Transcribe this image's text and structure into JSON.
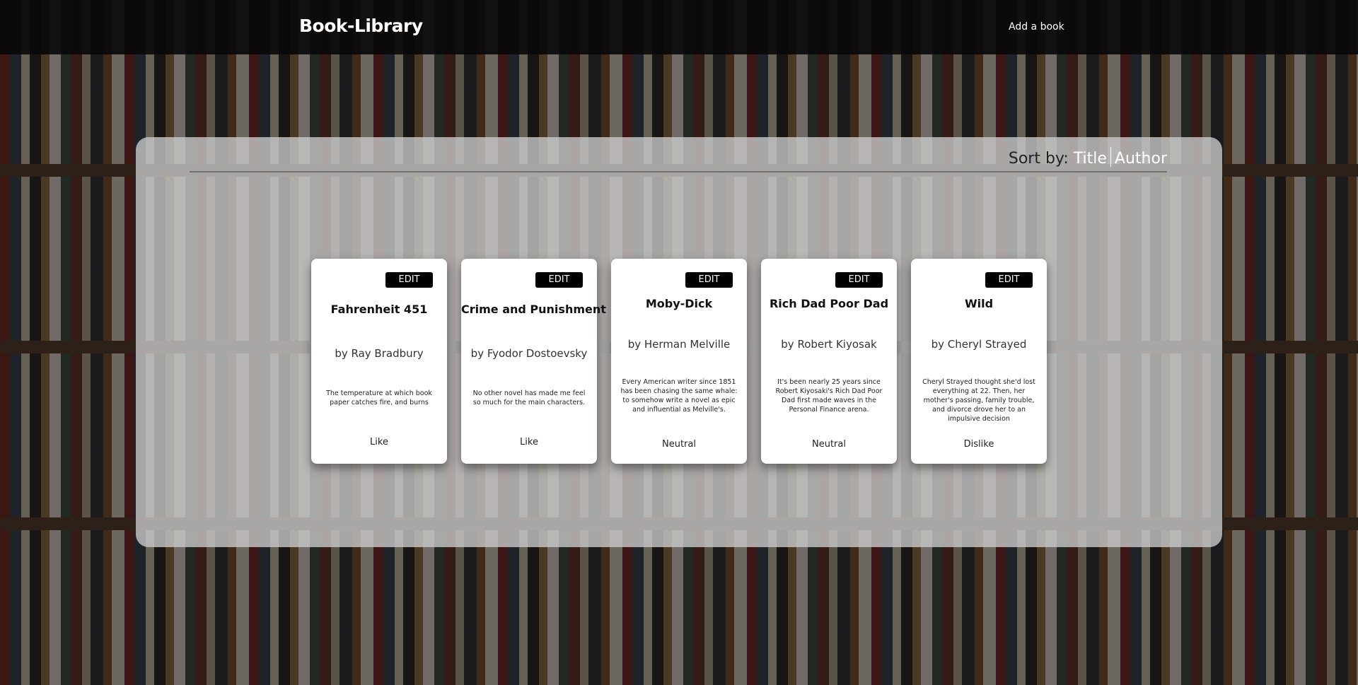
{
  "header": {
    "brand": "Book-Library",
    "add_book_link": "Add a book"
  },
  "sort": {
    "label": "Sort by:",
    "options": [
      "Title",
      "Author"
    ]
  },
  "books": [
    {
      "edit_label": "EDIT",
      "title": "Fahrenheit 451",
      "author": "by Ray Bradbury",
      "description": "The temperature at which book paper catches fire, and burns",
      "rating": "Like"
    },
    {
      "edit_label": "EDIT",
      "title": "Crime and Punishment",
      "author": "by Fyodor Dostoevsky",
      "description": "No other novel has made me feel so much for the main characters.",
      "rating": "Like"
    },
    {
      "edit_label": "EDIT",
      "title": "Moby-Dick",
      "author": "by Herman Melville",
      "description": "Every American writer since 1851 has been chasing the same whale: to somehow write a novel as epic and influential as Melville's.",
      "rating": "Neutral"
    },
    {
      "edit_label": "EDIT",
      "title": "Rich Dad Poor Dad",
      "author": "by Robert Kiyosak",
      "description": "It's been nearly 25 years since Robert Kiyosaki's Rich Dad Poor Dad first made waves in the Personal Finance arena.",
      "rating": "Neutral"
    },
    {
      "edit_label": "EDIT",
      "title": "Wild",
      "author": "by Cheryl Strayed",
      "description": "Cheryl Strayed thought she'd lost everything at 22. Then, her mother's passing, family trouble, and divorce drove her to an impulsive decision",
      "rating": "Dislike"
    }
  ]
}
